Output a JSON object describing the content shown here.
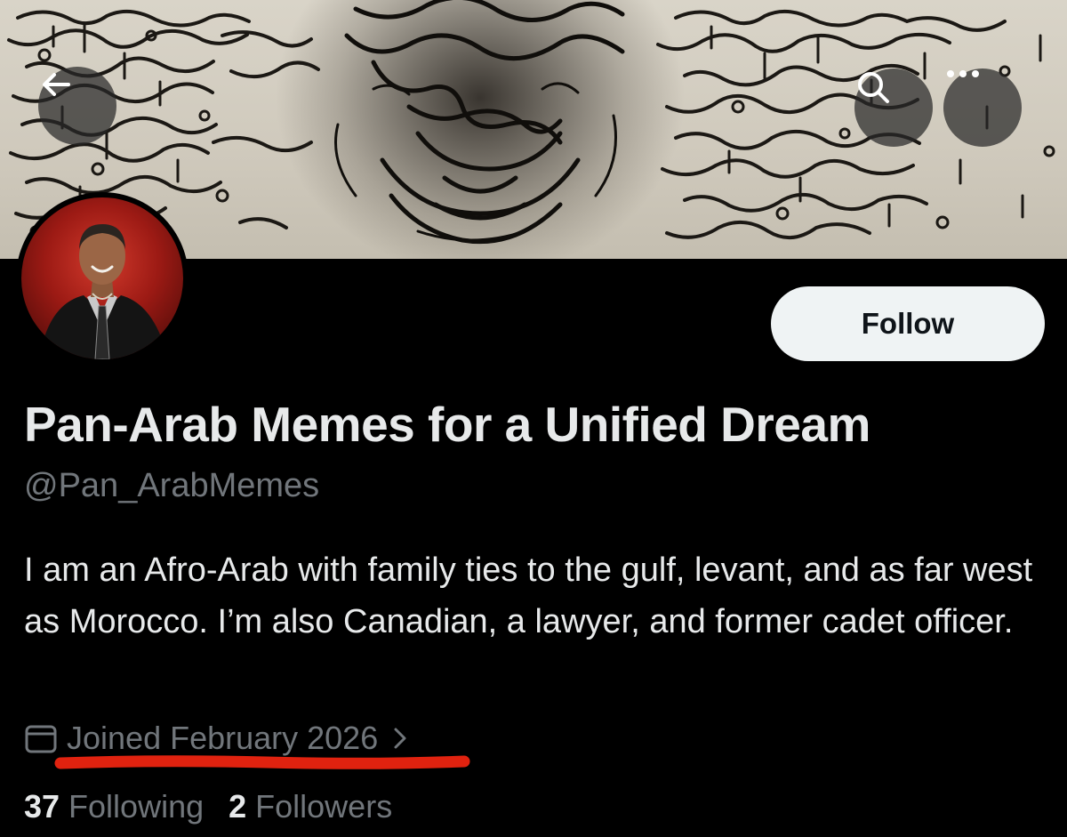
{
  "header": {
    "back_icon": "arrow-left-icon",
    "search_icon": "search-icon",
    "more_icon": "more-horizontal-icon"
  },
  "profile": {
    "display_name": "Pan-Arab Memes for a Unified Dream",
    "handle": "@Pan_ArabMemes",
    "bio": "I am an Afro-Arab with family ties to the gulf, levant, and as far west as Morocco. I’m also Canadian, a lawyer, and former cadet officer.",
    "joined": "Joined February 2026",
    "following_count": "37",
    "following_label": "Following",
    "followers_count": "2",
    "followers_label": "Followers"
  },
  "actions": {
    "follow_label": "Follow"
  },
  "colors": {
    "background": "#000000",
    "primary_text": "#e7e9ea",
    "secondary_text": "#71767b",
    "button_bg": "#eff3f4",
    "annotation_red": "#e0220f"
  }
}
